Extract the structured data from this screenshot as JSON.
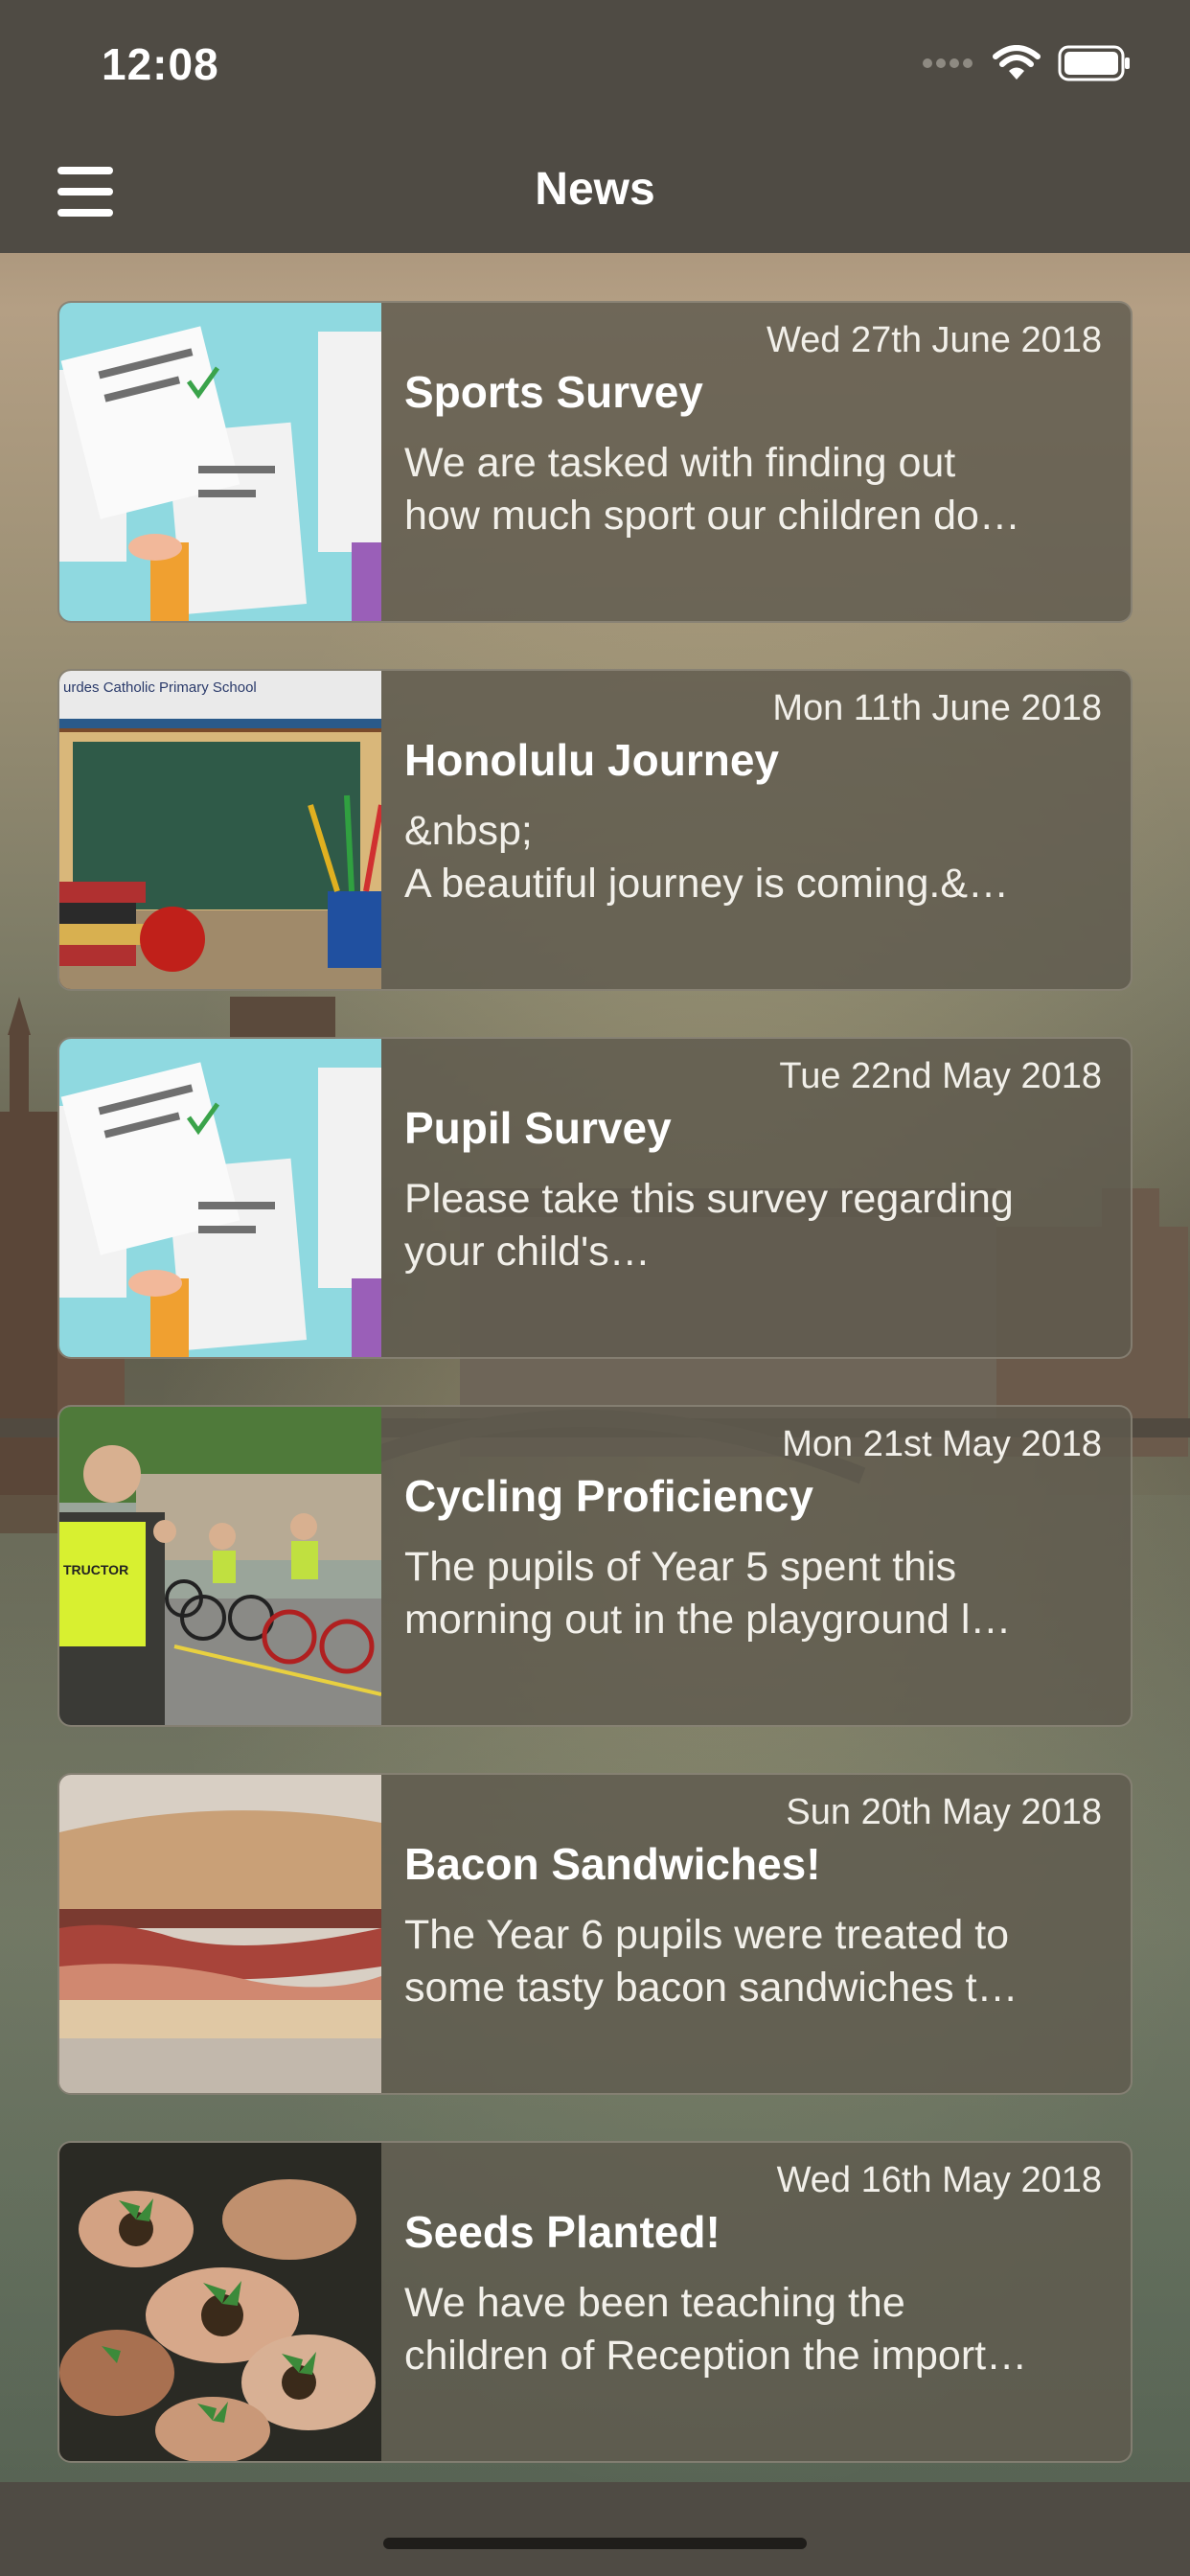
{
  "status_bar": {
    "time": "12:08"
  },
  "nav": {
    "title": "News"
  },
  "articles": [
    {
      "date": "Wed 27th June 2018",
      "title": "Sports Survey",
      "snippet": "We are tasked with finding out\nhow much sport our children do…",
      "thumb": "survey-papers"
    },
    {
      "date": "Mon 11th June 2018",
      "title": "Honolulu Journey",
      "snippet": "&nbsp;\nA beautiful journey is coming.&…",
      "thumb": "school-chalkboard",
      "thumb_text": "urdes Catholic Primary School"
    },
    {
      "date": "Tue 22nd May 2018",
      "title": "Pupil Survey",
      "snippet": "Please take this survey regarding\nyour child's…",
      "thumb": "survey-papers"
    },
    {
      "date": "Mon 21st May 2018",
      "title": "Cycling Proficiency",
      "snippet": "The pupils of Year 5 spent this\nmorning out in the playground l…",
      "thumb": "cycling-children",
      "thumb_text": "TRUCTOR"
    },
    {
      "date": "Sun 20th May 2018",
      "title": "Bacon Sandwiches!",
      "snippet": "The Year 6 pupils were treated to\nsome tasty bacon sandwiches t…",
      "thumb": "bacon-sandwich"
    },
    {
      "date": "Wed 16th May 2018",
      "title": "Seeds Planted!",
      "snippet": "We have been teaching the\nchildren of Reception the import…",
      "thumb": "hands-seedlings"
    }
  ],
  "colors": {
    "bar": "#4f4b44",
    "card": "#5f5a4e"
  }
}
